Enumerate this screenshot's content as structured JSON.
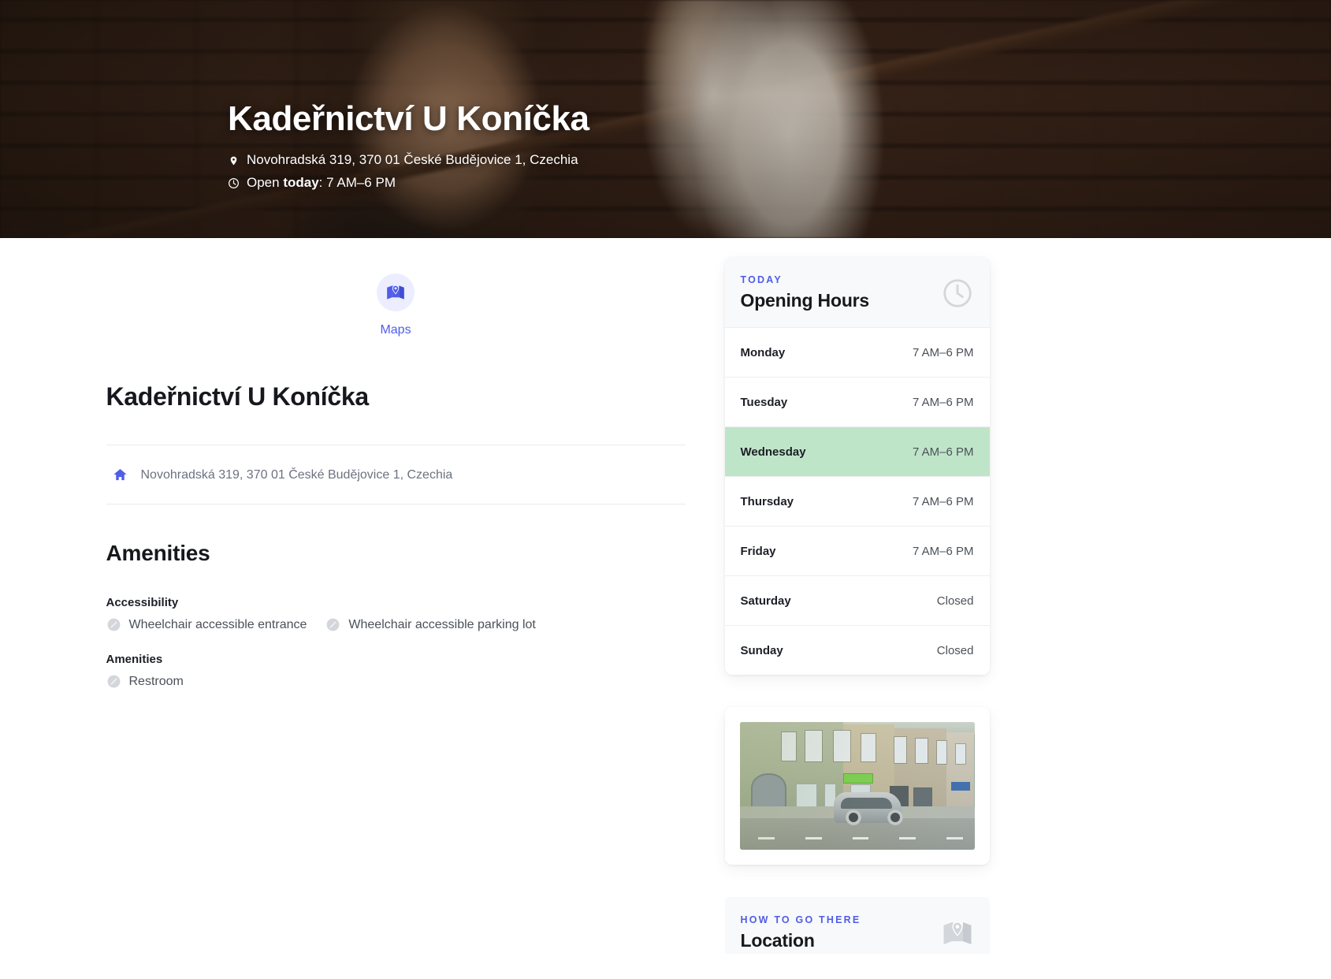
{
  "hero": {
    "title": "Kadeřnictví U Koníčka",
    "address": "Novohradská 319, 370 01 České Budějovice 1, Czechia",
    "hours_prefix": "Open ",
    "hours_today_word": "today",
    "hours_colon": ": ",
    "hours_value": "7 AM–6 PM",
    "location_icon": "map-pin-icon",
    "clock_icon": "clock-icon"
  },
  "main": {
    "maps": {
      "icon": "maps-icon",
      "label": "Maps"
    },
    "title": "Kadeřnictví U Koníčka",
    "address": {
      "icon": "home-icon",
      "text": "Novohradská 319, 370 01 České Budějovice 1, Czechia"
    },
    "amenities_heading": "Amenities",
    "groups": [
      {
        "heading": "Accessibility",
        "items": [
          {
            "icon": "ban-icon",
            "label": "Wheelchair accessible entrance"
          },
          {
            "icon": "ban-icon",
            "label": "Wheelchair accessible parking lot"
          }
        ]
      },
      {
        "heading": "Amenities",
        "items": [
          {
            "icon": "ban-icon",
            "label": "Restroom"
          }
        ]
      }
    ]
  },
  "sidebar": {
    "opening_hours": {
      "eyebrow": "TODAY",
      "heading": "Opening Hours",
      "icon": "clock-icon",
      "rows": [
        {
          "day": "Monday",
          "hours": "7 AM–6 PM",
          "today": false
        },
        {
          "day": "Tuesday",
          "hours": "7 AM–6 PM",
          "today": false
        },
        {
          "day": "Wednesday",
          "hours": "7 AM–6 PM",
          "today": true
        },
        {
          "day": "Thursday",
          "hours": "7 AM–6 PM",
          "today": false
        },
        {
          "day": "Friday",
          "hours": "7 AM–6 PM",
          "today": false
        },
        {
          "day": "Saturday",
          "hours": "Closed",
          "today": false
        },
        {
          "day": "Sunday",
          "hours": "Closed",
          "today": false
        }
      ]
    },
    "photo": {
      "name": "storefront-photo",
      "alt": "Street view of the salon building with a silver SUV parked in front"
    },
    "location": {
      "eyebrow": "HOW TO GO THERE",
      "heading": "Location",
      "icon": "maps-icon"
    }
  },
  "colors": {
    "accent": "#4f5de8",
    "accent_soft": "#eceeff",
    "today_highlight": "#bfe5c8",
    "text_dark": "#16181d",
    "text_muted": "#6b7280",
    "divider": "#e8eaed",
    "card_head_bg": "#f8f9fa"
  }
}
